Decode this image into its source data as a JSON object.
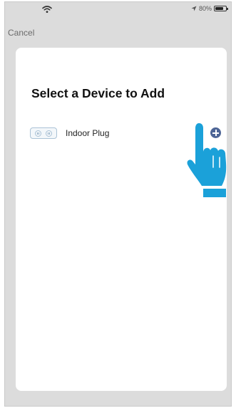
{
  "status_bar": {
    "battery_text": "80%",
    "battery_level": 0.8
  },
  "nav": {
    "cancel_label": "Cancel"
  },
  "sheet": {
    "title": "Select a Device to Add",
    "devices": [
      {
        "label": "Indoor Plug",
        "icon": "plug-icon",
        "action_icon": "plus-circle-icon"
      }
    ]
  },
  "colors": {
    "accent": "#4d6596",
    "pointer": "#1ba1d9",
    "frame_background": "#dcdcdc",
    "sheet_background": "#ffffff"
  },
  "overlay": {
    "pointer_icon": "hand-pointer-icon"
  }
}
